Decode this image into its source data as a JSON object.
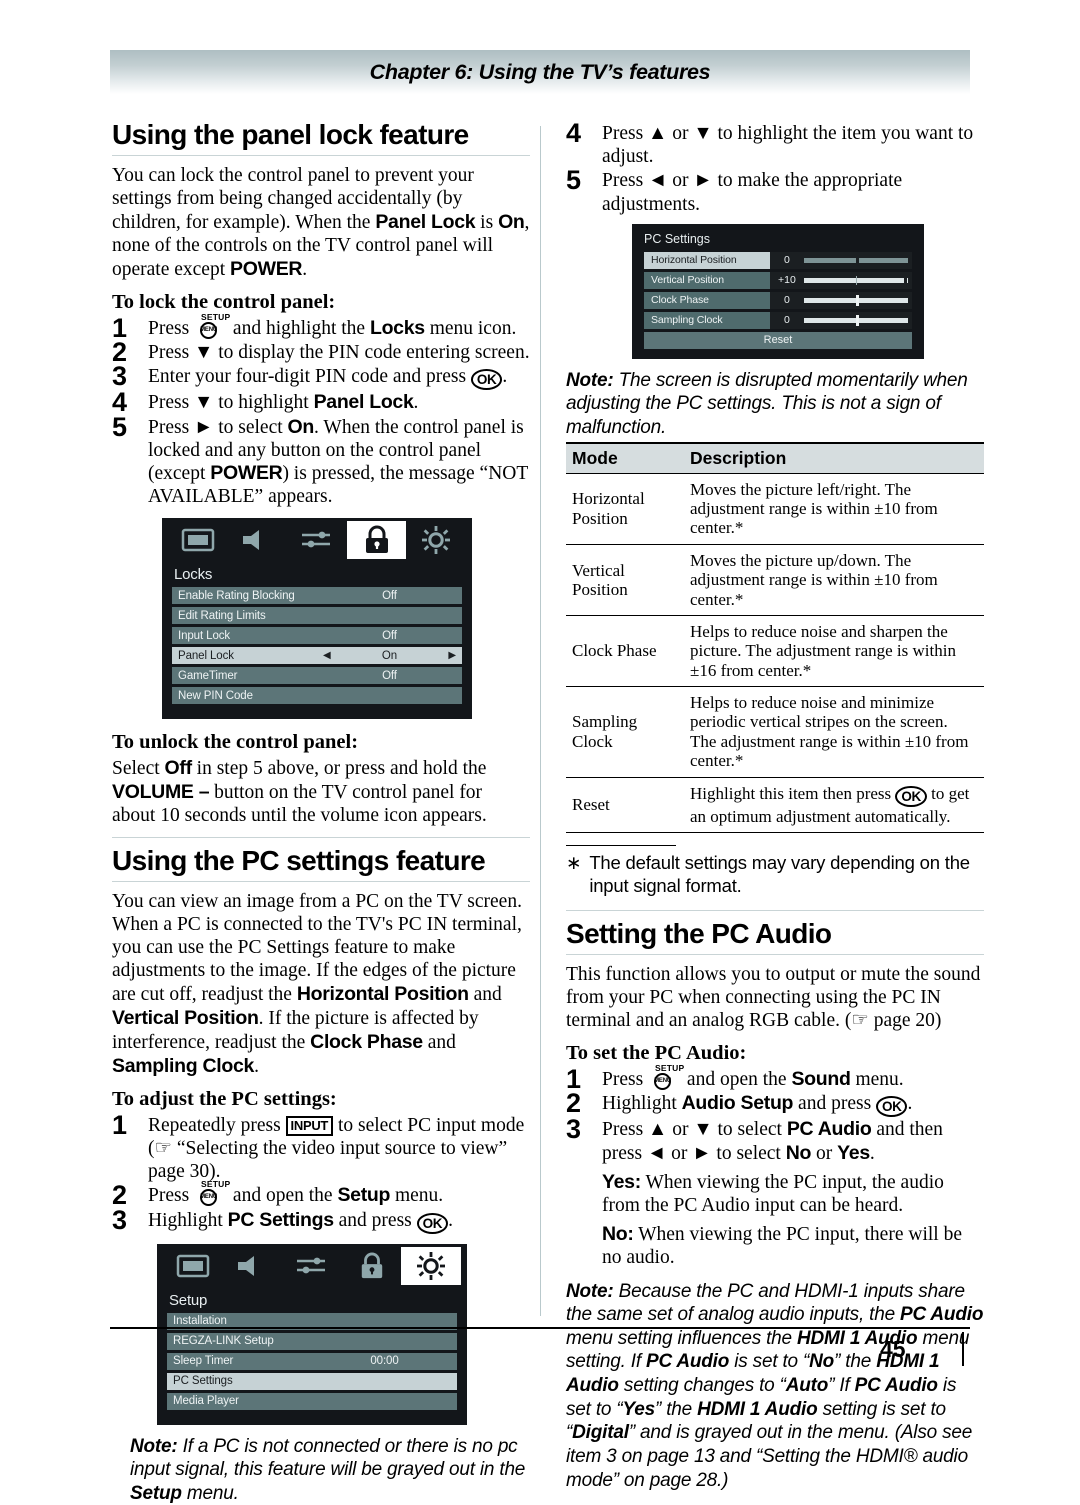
{
  "header": {
    "chapter": "Chapter 6: Using the TV’s features"
  },
  "footer": {
    "page_number": "45"
  },
  "left": {
    "section1_title": "Using the panel lock feature",
    "section1_intro_a": "You can lock the control panel to prevent your settings from being changed accidentally (by children, for example). When the ",
    "section1_intro_b": "Panel Lock",
    "section1_intro_c": " is ",
    "section1_intro_d": "On",
    "section1_intro_e": ", none of the controls on the TV control panel will operate except ",
    "section1_intro_f": "POWER",
    "section1_intro_g": ".",
    "lock_heading": "To lock the control panel:",
    "lock_steps": [
      {
        "num": "1",
        "pre": "Press ",
        "key": "setup",
        "mid": " and highlight the ",
        "bold": "Locks",
        "post": " menu icon."
      },
      {
        "num": "2",
        "text": "Press ▼ to display the PIN code entering screen."
      },
      {
        "num": "3",
        "pre": "Enter your four-digit PIN code and press ",
        "key": "ok",
        "post": "."
      },
      {
        "num": "4",
        "pre": "Press ▼ to highlight ",
        "bold": "Panel Lock",
        "post": "."
      },
      {
        "num": "5",
        "pre": "Press ► to select ",
        "bold": "On",
        "post": ". When the control panel is locked and any button on the control panel (except ",
        "bold2": "POWER",
        "post2": ") is pressed, the message “NOT AVAILABLE” appears."
      }
    ],
    "locks_osd": {
      "title": "Locks",
      "icons": [
        "picture-icon",
        "sound-icon",
        "preferences-icon",
        "locks-icon",
        "setup-icon"
      ],
      "active_icon_index": 3,
      "rows": [
        {
          "label": "Enable Rating Blocking",
          "value": "Off",
          "selected": false,
          "full": false
        },
        {
          "label": "Edit Rating Limits",
          "value": "",
          "selected": false,
          "full": true
        },
        {
          "label": "Input Lock",
          "value": "Off",
          "selected": false,
          "full": false
        },
        {
          "label": "Panel Lock",
          "value": "On",
          "selected": true,
          "full": false,
          "arrows": true
        },
        {
          "label": "GameTimer",
          "value": "Off",
          "selected": false,
          "full": false
        },
        {
          "label": "New PIN Code",
          "value": "",
          "selected": false,
          "full": true
        }
      ]
    },
    "unlock_heading": "To unlock the control panel:",
    "unlock_a": "Select ",
    "unlock_b": "Off",
    "unlock_c": " in step 5 above, or press and hold the ",
    "unlock_d": "VOLUME –",
    "unlock_e": " button on the TV control panel for about 10 seconds until the volume icon appears.",
    "section2_title": "Using the PC settings feature",
    "section2_intro_a": "You can view an image from a PC on the TV screen. When a PC is connected to the TV's PC IN terminal, you can use the PC Settings feature to make adjustments to the image. If the edges of the picture are cut off, readjust the ",
    "section2_intro_b": "Horizontal Position",
    "section2_intro_c": " and ",
    "section2_intro_d": "Vertical Position",
    "section2_intro_e": ". If the picture is affected by interference, readjust the ",
    "section2_intro_f": "Clock Phase",
    "section2_intro_g": " and ",
    "section2_intro_h": "Sampling Clock",
    "section2_intro_i": ".",
    "adjust_heading": "To adjust the PC settings:",
    "adjust_steps": [
      {
        "num": "1",
        "pre": "Repeatedly press ",
        "key": "input",
        "mid": " to select PC input mode (☞ “Selecting the video input source to view” page 30)."
      },
      {
        "num": "2",
        "pre": "Press ",
        "key": "setup",
        "mid": " and open the ",
        "bold": "Setup",
        "post": " menu."
      },
      {
        "num": "3",
        "pre": "Highlight ",
        "bold": "PC Settings",
        "mid2": " and press ",
        "key": "ok",
        "post": "."
      }
    ],
    "setup_osd": {
      "title": "Setup",
      "icons": [
        "picture-icon",
        "sound-icon",
        "preferences-icon",
        "locks-icon",
        "setup-icon"
      ],
      "active_icon_index": 4,
      "rows": [
        {
          "label": "Installation",
          "value": "",
          "selected": false,
          "full": true
        },
        {
          "label": "REGZA-LINK Setup",
          "value": "",
          "selected": false,
          "full": true
        },
        {
          "label": "Sleep Timer",
          "value": "00:00",
          "selected": false,
          "full": false
        },
        {
          "label": "PC Settings",
          "value": "",
          "selected": true,
          "full": true
        },
        {
          "label": "Media Player",
          "value": "",
          "selected": false,
          "full": true
        }
      ]
    },
    "note1_label": "Note:",
    "note1_a": " If a PC is not connected or there is no pc input signal, this feature will be grayed out in the ",
    "note1_b": "Setup",
    "note1_c": " menu."
  },
  "right": {
    "steps_top": [
      {
        "num": "4",
        "text": "Press ▲ or ▼ to highlight the item you want to adjust."
      },
      {
        "num": "5",
        "text": "Press ◄ or ► to make the appropriate adjustments."
      }
    ],
    "pc_settings_osd": {
      "title": "PC Settings",
      "rows": [
        {
          "label": "Horizontal Position",
          "value": "0",
          "selected": true,
          "knob_pct": 50,
          "tick": false
        },
        {
          "label": "Vertical Position",
          "value": "+10",
          "selected": false,
          "knob_pct": 97,
          "tick": true
        },
        {
          "label": "Clock Phase",
          "value": "0",
          "selected": false,
          "knob_pct": 50,
          "tick": false
        },
        {
          "label": "Sampling Clock",
          "value": "0",
          "selected": false,
          "knob_pct": 50,
          "tick": false
        }
      ],
      "reset_label": "Reset"
    },
    "note2_label": "Note:",
    "note2_text": " The screen is disrupted momentarily when adjusting the PC settings. This is not a sign of malfunction.",
    "table": {
      "headers": [
        "Mode",
        "Description"
      ],
      "rows": [
        {
          "mode": "Horizontal Position",
          "desc": "Moves the picture left/right. The adjustment range is within ±10 from center.*"
        },
        {
          "mode": "Vertical Position",
          "desc": "Moves the picture up/down. The adjustment range is within ±10 from center.*"
        },
        {
          "mode": "Clock Phase",
          "desc": "Helps to reduce noise and sharpen the picture. The adjustment range is within ±16 from center.*"
        },
        {
          "mode": "Sampling Clock",
          "desc": "Helps to reduce noise and minimize periodic vertical stripes on the screen. The adjustment range is within ±10 from center.*"
        },
        {
          "mode": "Reset",
          "desc_pre": "Highlight this item then press ",
          "desc_key": "ok",
          "desc_post": " to get an optimum adjustment automatically."
        }
      ]
    },
    "footnote_mark": "∗",
    "footnote_text": "The default settings may vary depending on the input signal format.",
    "section3_title": "Setting the PC Audio",
    "section3_intro": "This function allows you to output or mute the sound from your PC when connecting using the PC IN terminal and an analog RGB cable. (☞ page 20)",
    "pcaudio_heading": "To set the PC Audio:",
    "pcaudio_steps": [
      {
        "num": "1",
        "pre": "Press ",
        "key": "setup",
        "mid": " and open the ",
        "bold": "Sound",
        "post": " menu."
      },
      {
        "num": "2",
        "pre": "Highlight ",
        "bold": "Audio Setup",
        "mid2": " and press ",
        "key": "ok",
        "post": "."
      },
      {
        "num": "3",
        "pre": "Press ▲ or ▼ to select ",
        "bold": "PC Audio",
        "post": " and then press ◄ or ► to select ",
        "bold2": "No",
        "post2": " or ",
        "bold3": "Yes",
        "post3": "."
      }
    ],
    "yes_label": "Yes:",
    "yes_text": " When viewing the PC input, the audio from the PC Audio input can be heard.",
    "no_label": "No:",
    "no_text": " When viewing the PC input, there will be no audio.",
    "note3_label": "Note:",
    "note3_p1": " Because the PC and HDMI-1 inputs share the same set of analog audio inputs, the ",
    "note3_b1": "PC Audio",
    "note3_p2": " menu setting influences the ",
    "note3_b2": "HDMI 1 Audio",
    "note3_p3": " menu setting. If ",
    "note3_b3": "PC Audio",
    "note3_p4": " is set to “",
    "note3_b4": "No",
    "note3_p5": "” the ",
    "note3_b5": "HDMI 1 Audio",
    "note3_p6": " setting changes to “",
    "note3_b6": "Auto",
    "note3_p7": "” If ",
    "note3_b7": "PC Audio",
    "note3_p8": " is set to “",
    "note3_b8": "Yes",
    "note3_p9": "” the ",
    "note3_b9": "HDMI 1 Audio",
    "note3_p10": " setting is set to “",
    "note3_b10": "Digital",
    "note3_p11": "” and is grayed out in the menu. (Also see item 3 on page 13 and “Setting the HDMI® audio mode” on page 28.)"
  }
}
